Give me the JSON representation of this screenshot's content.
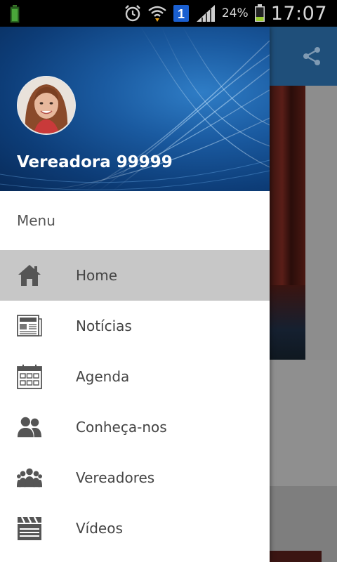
{
  "status_bar": {
    "battery_percent": "24%",
    "time": "17:07",
    "notification_badge": "1",
    "icons": [
      "battery-charging-icon",
      "alarm-icon",
      "wifi-icon",
      "notification-1-icon",
      "signal-icon",
      "battery-icon"
    ]
  },
  "app": {
    "toolbar_color": "#1f4f7a",
    "share_icon": "share-icon"
  },
  "drawer": {
    "profile_name": "Vereadora 99999",
    "menu_title": "Menu",
    "items": [
      {
        "label": "Home",
        "icon": "home-icon",
        "active": true
      },
      {
        "label": "Notícias",
        "icon": "newspaper-icon",
        "active": false
      },
      {
        "label": "Agenda",
        "icon": "calendar-icon",
        "active": false
      },
      {
        "label": "Conheça-nos",
        "icon": "people-icon",
        "active": false
      },
      {
        "label": "Vereadores",
        "icon": "group-icon",
        "active": false
      },
      {
        "label": "Vídeos",
        "icon": "clapperboard-icon",
        "active": false
      }
    ],
    "active_color": "#c7c7c7",
    "icon_color": "#555555"
  }
}
